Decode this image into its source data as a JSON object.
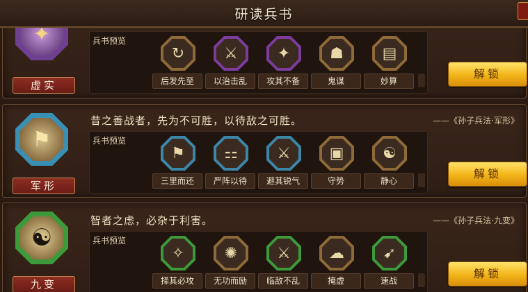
{
  "header": {
    "title": "研读兵书"
  },
  "sections": [
    {
      "name": "虚实",
      "preview_label": "兵书预览",
      "books": [
        {
          "label": "后发先至",
          "icon": "arrow-swirl-icon",
          "glyph": "↻"
        },
        {
          "label": "以治击乱",
          "icon": "warrior-icon",
          "glyph": "⚔"
        },
        {
          "label": "攻其不备",
          "icon": "dancer-icon",
          "glyph": "✦"
        },
        {
          "label": "鬼谋",
          "icon": "strategist-icon",
          "glyph": "☗"
        },
        {
          "label": "妙算",
          "icon": "scroll-icon",
          "glyph": "▤"
        }
      ],
      "unlock_label": "解锁"
    },
    {
      "name": "军形",
      "quote": "昔之善战者，先为不可胜，以待敌之可胜。",
      "source": "——《孙子兵法·军形》",
      "preview_label": "兵书预览",
      "books": [
        {
          "label": "三里而还",
          "icon": "banner-icon",
          "glyph": "⚑"
        },
        {
          "label": "严阵以待",
          "icon": "army-formation-icon",
          "glyph": "⚏"
        },
        {
          "label": "避其锐气",
          "icon": "soldier-icon",
          "glyph": "⚔"
        },
        {
          "label": "守势",
          "icon": "fortress-icon",
          "glyph": "▣"
        },
        {
          "label": "静心",
          "icon": "meditation-icon",
          "glyph": "☯"
        }
      ],
      "unlock_label": "解锁"
    },
    {
      "name": "九变",
      "quote": "智者之虑，必杂于利害。",
      "source": "——《孙子兵法·九变》",
      "preview_label": "兵书预览",
      "books": [
        {
          "label": "择其必攻",
          "icon": "target-icon",
          "glyph": "✧"
        },
        {
          "label": "无功而励",
          "icon": "cheer-icon",
          "glyph": "✺"
        },
        {
          "label": "临敌不乱",
          "icon": "calm-warrior-icon",
          "glyph": "⚔"
        },
        {
          "label": "掩虚",
          "icon": "cloak-icon",
          "glyph": "☁"
        },
        {
          "label": "速战",
          "icon": "charge-icon",
          "glyph": "➹"
        }
      ],
      "unlock_label": "解锁"
    }
  ]
}
